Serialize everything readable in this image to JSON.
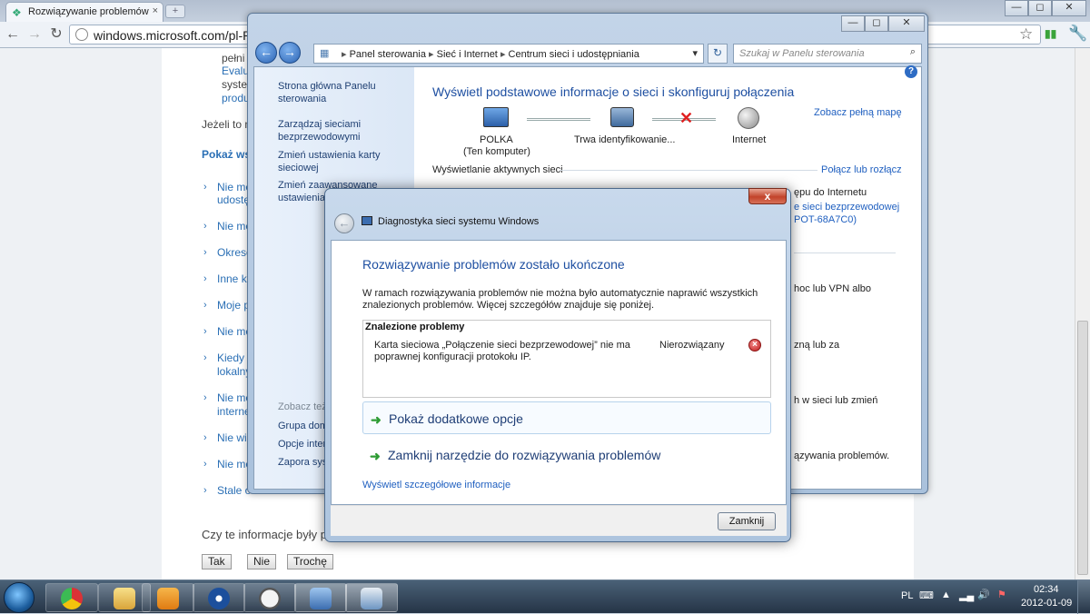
{
  "browser": {
    "tab_title": "Rozwiązywanie problemów",
    "tab_close": "×",
    "new_tab": "+",
    "url": "windows.microsoft.com/pl-PL",
    "win_minimize": "—",
    "win_maximize": "◻",
    "win_close": "✕"
  },
  "webpage": {
    "top_text": [
      "pełni",
      "Evalu",
      "syste",
      "produ"
    ],
    "if_text": "Jeżeli to m",
    "show_all": "Pokaż ws",
    "list": [
      "Nie me",
      "udostę",
      "Nie me",
      "Okreso",
      "Inne ko",
      "Moje p",
      "Nie me",
      "Kiedy p",
      "lokalny",
      "Nie me",
      "interne",
      "Nie wid",
      "Nie me",
      "Stale o"
    ],
    "helpful_question": "Czy te informacje były pr",
    "btn_yes": "Tak",
    "btn_no": "Nie",
    "btn_somewhat": "Trochę"
  },
  "control_panel": {
    "breadcrumb": [
      "Panel sterowania",
      "Sieć i Internet",
      "Centrum sieci i udostępniania"
    ],
    "search_placeholder": "Szukaj w Panelu sterowania",
    "sidebar": {
      "home": "Strona główna Panelu sterowania",
      "link1": "Zarządzaj sieciami bezprzewodowymi",
      "link2": "Zmień ustawienia karty sieciowej",
      "link3": "Zmień zaawansowane ustawienia",
      "see_also": "Zobacz też",
      "see1": "Grupa dom",
      "see2": "Opcje inter",
      "see3": "Zapora syst"
    },
    "heading": "Wyświetl podstawowe informacje o sieci i skonfiguruj połączenia",
    "full_map": "Zobacz pełną mapę",
    "node1_name": "POLKA",
    "node1_sub": "(Ten komputer)",
    "node2_name": "Trwa identyfikowanie...",
    "node3_name": "Internet",
    "active_networks": "Wyświetlanie aktywnych sieci",
    "connect_disconnect": "Połącz lub rozłącz",
    "access": "ępu do Internetu",
    "wireless_link": "e sieci bezprzewodowej",
    "wireless_link2": "POT-68A7C0)",
    "right1": "hoc lub VPN albo",
    "right2": "zną lub za",
    "right3": "h w sieci lub zmień",
    "right4": "ązywania problemów."
  },
  "dialog": {
    "close": "x",
    "back": "←",
    "title": "Diagnostyka sieci systemu Windows",
    "heading": "Rozwiązywanie problemów zostało ukończone",
    "description": "W ramach rozwiązywania problemów nie można było automatycznie naprawić wszystkich znalezionych problemów. Więcej szczegółów znajduje się poniżej.",
    "problems_header": "Znalezione problemy",
    "problem_text": "Karta sieciowa „Połączenie sieci bezprzewodowej” nie ma poprawnej konfiguracji protokołu IP.",
    "problem_status": "Nierozwiązany",
    "option1": "Pokaż dodatkowe opcje",
    "option2": "Zamknij narzędzie do rozwiązywania problemów",
    "details_link": "Wyświetl szczegółowe informacje",
    "close_button": "Zamknij"
  },
  "taskbar": {
    "language": "PL",
    "time": "02:34",
    "date": "2012-01-09"
  }
}
